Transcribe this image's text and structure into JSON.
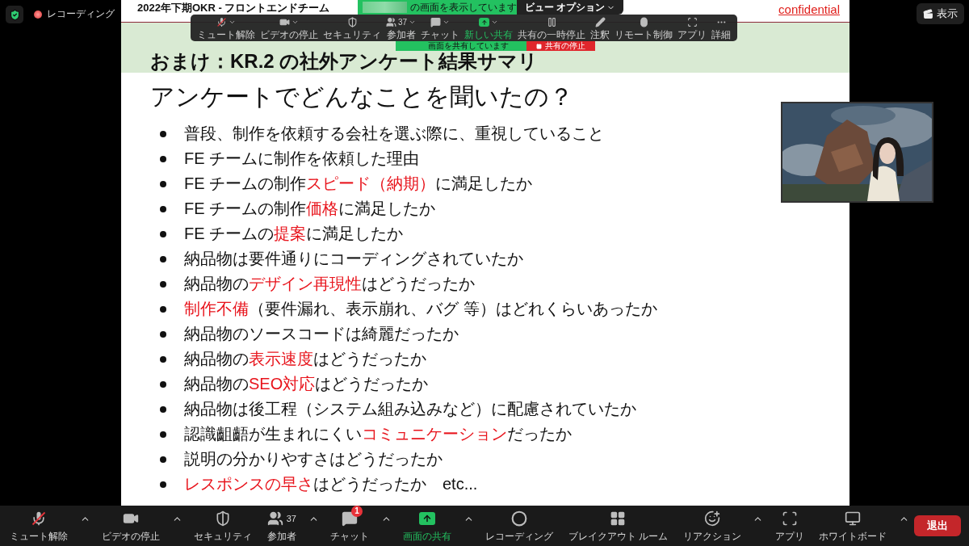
{
  "status": {
    "secure": true,
    "recording_label": "レコーディング"
  },
  "view_button": {
    "label": "表示"
  },
  "share_banner": {
    "text": "の画面を表示しています",
    "view_options": "ビュー オプション"
  },
  "slide": {
    "title": "2022年下期OKR - フロントエンドチーム",
    "confidential": "confidential",
    "section_title": "おまけ：KR.2 の社外アンケート結果サマリ",
    "heading": "アンケートでどんなことを聞いたの？",
    "items": [
      {
        "parts": [
          {
            "text": "普段、制作を依頼する会社を選ぶ際に、重視していること",
            "highlight": false
          }
        ]
      },
      {
        "parts": [
          {
            "text": "FE チームに制作を依頼した理由",
            "highlight": false
          }
        ]
      },
      {
        "parts": [
          {
            "text": "FE チームの制作",
            "highlight": false
          },
          {
            "text": "スピード（納期）",
            "highlight": true
          },
          {
            "text": "に満足したか",
            "highlight": false
          }
        ]
      },
      {
        "parts": [
          {
            "text": "FE チームの制作",
            "highlight": false
          },
          {
            "text": "価格",
            "highlight": true
          },
          {
            "text": "に満足したか",
            "highlight": false
          }
        ]
      },
      {
        "parts": [
          {
            "text": "FE チームの",
            "highlight": false
          },
          {
            "text": "提案",
            "highlight": true
          },
          {
            "text": "に満足したか",
            "highlight": false
          }
        ]
      },
      {
        "parts": [
          {
            "text": "納品物は要件通りにコーディングされていたか",
            "highlight": false
          }
        ]
      },
      {
        "parts": [
          {
            "text": "納品物の",
            "highlight": false
          },
          {
            "text": "デザイン再現性",
            "highlight": true
          },
          {
            "text": "はどうだったか",
            "highlight": false
          }
        ]
      },
      {
        "parts": [
          {
            "text": "制作不備",
            "highlight": true
          },
          {
            "text": "（要件漏れ、表示崩れ、バグ 等）はどれくらいあったか",
            "highlight": false
          }
        ]
      },
      {
        "parts": [
          {
            "text": "納品物のソースコードは綺麗だったか",
            "highlight": false
          }
        ]
      },
      {
        "parts": [
          {
            "text": "納品物の",
            "highlight": false
          },
          {
            "text": "表示速度",
            "highlight": true
          },
          {
            "text": "はどうだったか",
            "highlight": false
          }
        ]
      },
      {
        "parts": [
          {
            "text": "納品物の",
            "highlight": false
          },
          {
            "text": "SEO対応",
            "highlight": true
          },
          {
            "text": "はどうだったか",
            "highlight": false
          }
        ]
      },
      {
        "parts": [
          {
            "text": "納品物は後工程（システム組み込みなど）に配慮されていたか",
            "highlight": false
          }
        ]
      },
      {
        "parts": [
          {
            "text": "認識齟齬が生まれにくい",
            "highlight": false
          },
          {
            "text": "コミュニケーション",
            "highlight": true
          },
          {
            "text": "だったか",
            "highlight": false
          }
        ]
      },
      {
        "parts": [
          {
            "text": "説明の分かりやすさはどうだったか",
            "highlight": false
          }
        ]
      },
      {
        "parts": [
          {
            "text": "レスポンスの早さ",
            "highlight": true
          },
          {
            "text": "はどうだったか　etc...",
            "highlight": false
          }
        ]
      }
    ]
  },
  "share_toolbar": {
    "items": [
      {
        "kind": "mic",
        "label": "ミュート解除",
        "muted": true,
        "caret": true,
        "active": false
      },
      {
        "kind": "video",
        "label": "ビデオの停止",
        "caret": true,
        "active": false
      },
      {
        "kind": "security",
        "label": "セキュリティ",
        "caret": false,
        "active": false
      },
      {
        "kind": "participants",
        "label": "参加者",
        "count": "37",
        "caret": true,
        "active": false
      },
      {
        "kind": "chat",
        "label": "チャット",
        "caret": true,
        "active": false
      },
      {
        "kind": "share",
        "label": "新しい共有",
        "caret": true,
        "active": true
      },
      {
        "kind": "pause",
        "label": "共有の一時停止",
        "caret": false,
        "active": false
      },
      {
        "kind": "annotate",
        "label": "注釈",
        "caret": false,
        "active": false
      },
      {
        "kind": "remote",
        "label": "リモート制御",
        "caret": false,
        "active": false
      },
      {
        "kind": "apps",
        "label": "アプリ",
        "caret": false,
        "active": false
      },
      {
        "kind": "more",
        "label": "詳細",
        "caret": false,
        "active": false
      }
    ],
    "sharing_text": "画面を共有しています",
    "stop_label": "共有の停止"
  },
  "toolbar": {
    "items": [
      {
        "kind": "mic",
        "label": "ミュート解除",
        "muted": true,
        "caret": true,
        "active": false
      },
      {
        "kind": "video",
        "label": "ビデオの停止",
        "caret": true,
        "active": false
      },
      {
        "kind": "security",
        "label": "セキュリティ",
        "caret": false,
        "active": false
      },
      {
        "kind": "participants",
        "label": "参加者",
        "count": "37",
        "caret": true,
        "active": false
      },
      {
        "kind": "chat",
        "label": "チャット",
        "badge": "1",
        "caret": true,
        "active": false
      },
      {
        "kind": "share",
        "label": "画面の共有",
        "caret": true,
        "active": true
      },
      {
        "kind": "record",
        "label": "レコーディング",
        "caret": false,
        "active": false
      },
      {
        "kind": "breakout",
        "label": "ブレイクアウト ルーム",
        "caret": false,
        "active": false
      },
      {
        "kind": "reaction",
        "label": "リアクション",
        "caret": true,
        "active": false
      },
      {
        "kind": "apps",
        "label": "アプリ",
        "caret": false,
        "active": false
      },
      {
        "kind": "whiteboard",
        "label": "ホワイトボード",
        "caret": true,
        "active": false
      }
    ],
    "leave_label": "退出"
  }
}
